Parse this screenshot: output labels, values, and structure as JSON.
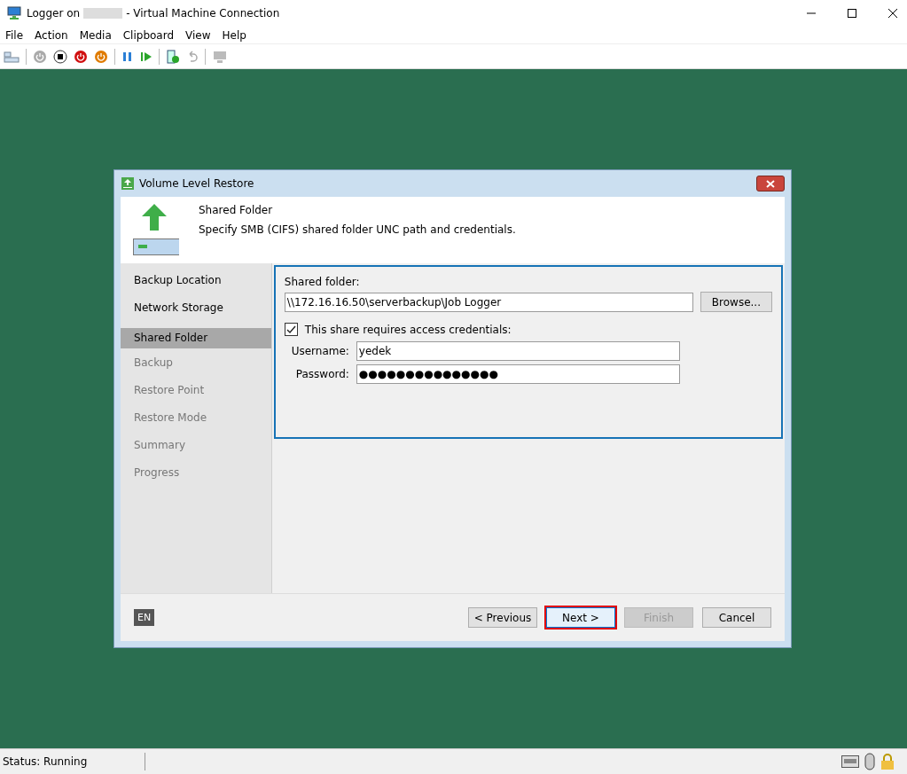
{
  "window": {
    "title_prefix": "Logger on",
    "title_suffix": "- Virtual Machine Connection"
  },
  "menu": [
    "File",
    "Action",
    "Media",
    "Clipboard",
    "View",
    "Help"
  ],
  "dialog": {
    "title": "Volume Level Restore",
    "step_title": "Shared Folder",
    "step_description": "Specify SMB (CIFS) shared folder UNC path and credentials.",
    "steps": [
      {
        "label": "Backup Location",
        "selected": false,
        "disabled": false
      },
      {
        "label": "Network Storage",
        "selected": false,
        "disabled": false
      },
      {
        "label": "Shared Folder",
        "selected": true,
        "disabled": false
      },
      {
        "label": "Backup",
        "selected": false,
        "disabled": true
      },
      {
        "label": "Restore Point",
        "selected": false,
        "disabled": true
      },
      {
        "label": "Restore Mode",
        "selected": false,
        "disabled": true
      },
      {
        "label": "Summary",
        "selected": false,
        "disabled": true
      },
      {
        "label": "Progress",
        "selected": false,
        "disabled": true
      }
    ],
    "shared_folder_label": "Shared folder:",
    "shared_folder_value": "\\\\172.16.16.50\\serverbackup\\Job Logger",
    "browse_button": "Browse...",
    "credentials": {
      "label": "This share requires access credentials:",
      "checked": true
    },
    "username_label": "Username:",
    "username_value": "yedek",
    "password_label": "Password:",
    "password_value": "●●●●●●●●●●●●●●●",
    "language": "EN",
    "buttons": [
      {
        "label": "< Previous",
        "disabled": false,
        "highlighted": false
      },
      {
        "label": "Next >",
        "disabled": false,
        "highlighted": true
      },
      {
        "label": "Finish",
        "disabled": true,
        "highlighted": false
      },
      {
        "label": "Cancel",
        "disabled": false,
        "highlighted": false
      }
    ]
  },
  "status_bar": {
    "status": "Status: Running"
  }
}
